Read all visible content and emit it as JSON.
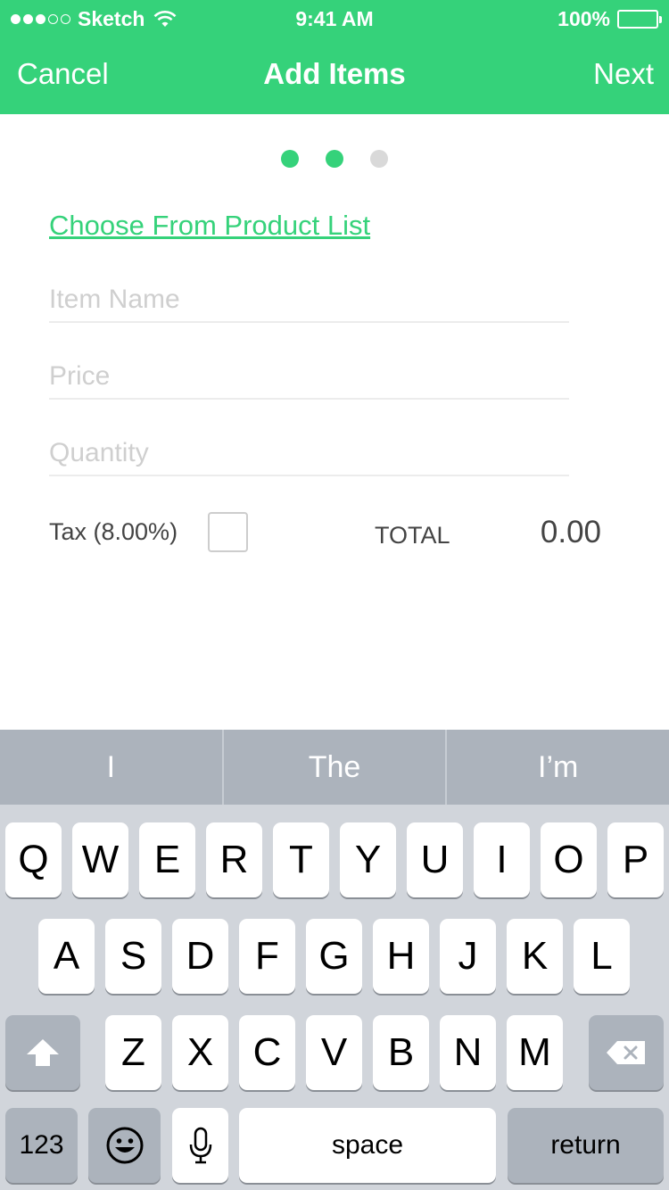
{
  "status_bar": {
    "carrier": "Sketch",
    "time": "9:41 AM",
    "battery": "100%"
  },
  "nav": {
    "cancel": "Cancel",
    "title": "Add Items",
    "next": "Next"
  },
  "pager": {
    "total": 3,
    "current": 2
  },
  "form": {
    "product_link": "Choose From Product List",
    "item_name_placeholder": "Item Name",
    "price_placeholder": "Price",
    "quantity_placeholder": "Quantity",
    "tax_label": "Tax (8.00%)",
    "tax_checked": false,
    "total_label": "TOTAL",
    "total_value": "0.00"
  },
  "keyboard": {
    "suggestions": [
      "I",
      "The",
      "I’m"
    ],
    "row1": [
      "Q",
      "W",
      "E",
      "R",
      "T",
      "Y",
      "U",
      "I",
      "O",
      "P"
    ],
    "row2": [
      "A",
      "S",
      "D",
      "F",
      "G",
      "H",
      "J",
      "K",
      "L"
    ],
    "row3": [
      "Z",
      "X",
      "C",
      "V",
      "B",
      "N",
      "M"
    ],
    "numbers_key": "123",
    "space_key": "space",
    "return_key": "return",
    "icons": [
      "shift-icon",
      "backspace-icon",
      "emoji-icon",
      "microphone-icon"
    ]
  },
  "colors": {
    "accent": "#35d27a",
    "keyboard_bg": "#d1d5db",
    "special_key": "#acb3bc"
  }
}
